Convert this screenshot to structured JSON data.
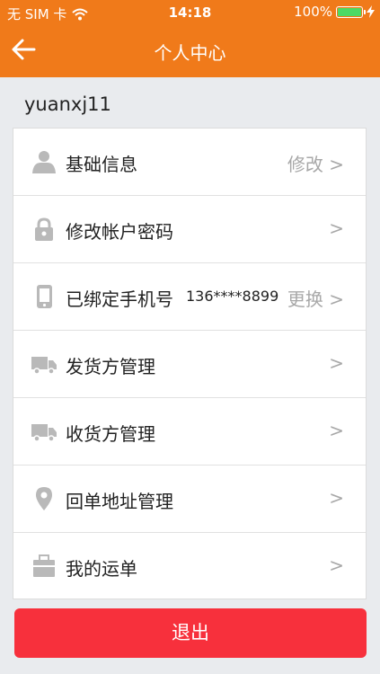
{
  "status_bar": {
    "carrier": "无 SIM 卡",
    "time": "14:18",
    "battery_text": "100%",
    "battery_level": 1.0,
    "wifi_icon": "wifi-icon",
    "charging_icon": "bolt-icon"
  },
  "header": {
    "title": "个人中心",
    "back_icon": "arrow-left-icon",
    "color": "#f07a1a"
  },
  "user": {
    "username": "yuanxj11"
  },
  "menu": [
    {
      "label": "基础信息",
      "action": "修改 >",
      "icon": "user-icon"
    },
    {
      "label": "修改帐户密码",
      "action": ">",
      "icon": "lock-icon"
    },
    {
      "label": "已绑定手机号",
      "value": "136****8899",
      "action": "更换 >",
      "icon": "phone-icon"
    },
    {
      "label": "发货方管理",
      "action": ">",
      "icon": "truck-icon"
    },
    {
      "label": "收货方管理",
      "action": ">",
      "icon": "truck-icon"
    },
    {
      "label": "回单地址管理",
      "action": ">",
      "icon": "location-pin-icon"
    },
    {
      "label": "我的运单",
      "action": ">",
      "icon": "briefcase-icon"
    }
  ],
  "logout": {
    "label": "退出",
    "color": "#f7303c"
  }
}
